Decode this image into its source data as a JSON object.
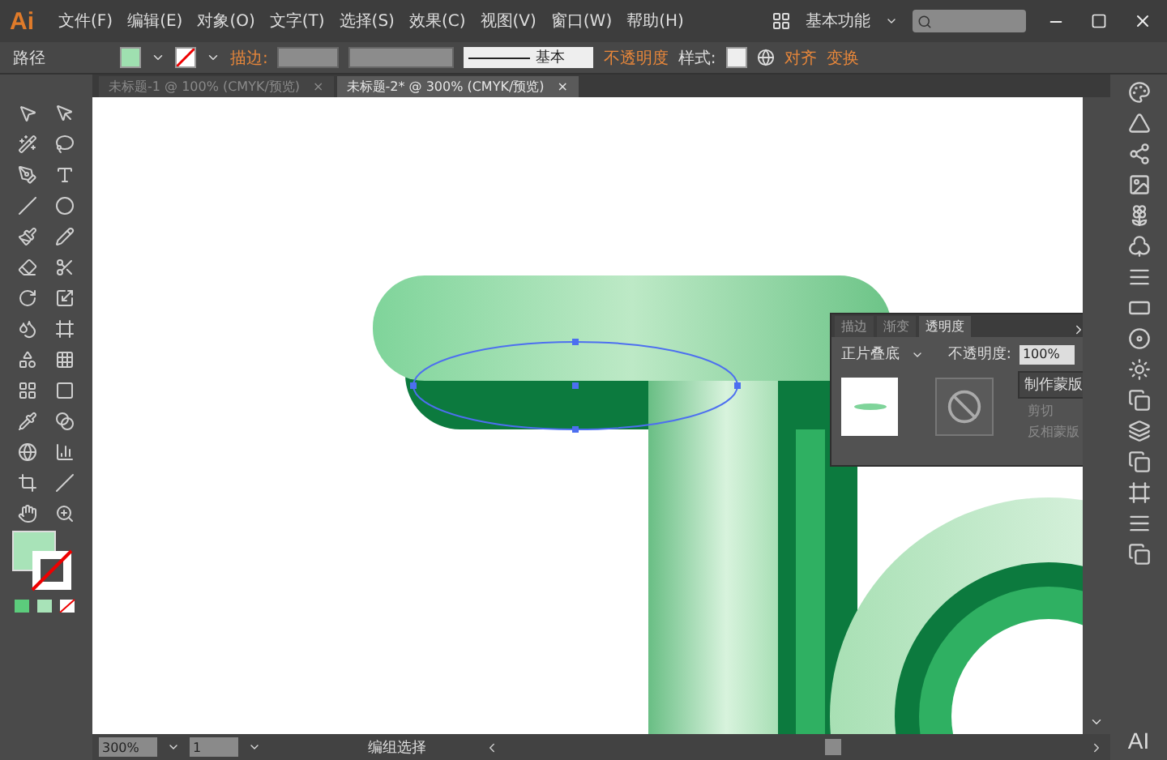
{
  "app": {
    "logo": "Ai",
    "workspace": "基本功能"
  },
  "menu": [
    "文件(F)",
    "编辑(E)",
    "对象(O)",
    "文字(T)",
    "选择(S)",
    "效果(C)",
    "视图(V)",
    "窗口(W)",
    "帮助(H)"
  ],
  "control_bar": {
    "selection": "路径",
    "stroke_label": "描边:",
    "stroke_style": "基本",
    "opacity_label": "不透明度",
    "style_label": "样式:",
    "align": "对齐",
    "transform": "变换"
  },
  "tabs": [
    {
      "label": "未标题-1 @ 100% (CMYK/预览)",
      "close": "×",
      "selected": false
    },
    {
      "label": "未标题-2* @ 300% (CMYK/预览)",
      "close": "×",
      "selected": true
    }
  ],
  "transparency_panel": {
    "tabs": [
      {
        "label": "描边",
        "selected": false
      },
      {
        "label": "渐变",
        "selected": false
      },
      {
        "label": "透明度",
        "selected": true
      }
    ],
    "blend_mode": "正片叠底",
    "opacity_label": "不透明度:",
    "opacity": "100%",
    "make_mask": "制作蒙版",
    "options": [
      {
        "label": "剪切",
        "disabled": true
      },
      {
        "label": "反相蒙版",
        "disabled": true
      }
    ]
  },
  "status_bar": {
    "zoom": "300%",
    "artboard": "1",
    "tool": "编组选择"
  },
  "dock_logo": "AI"
}
